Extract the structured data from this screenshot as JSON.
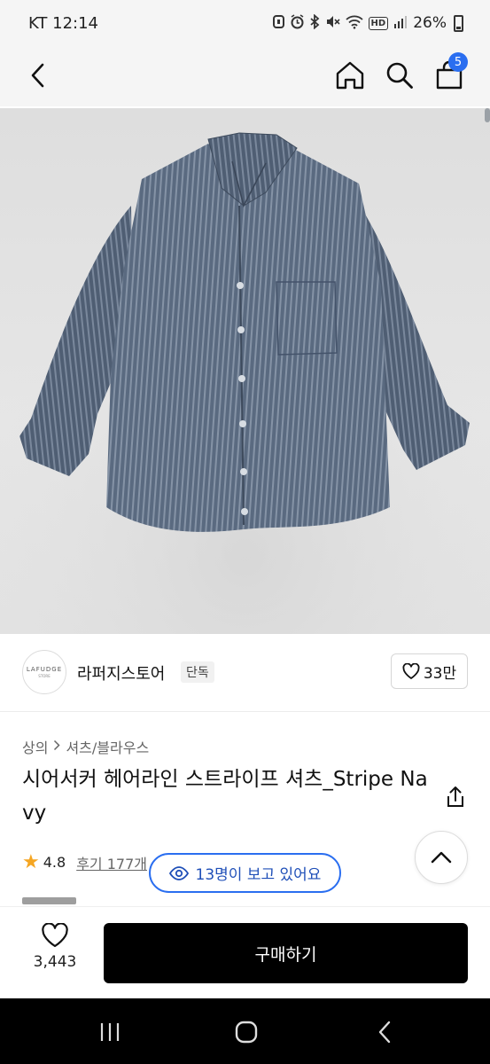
{
  "status_bar": {
    "carrier_time": "KT 12:14",
    "battery": "26%",
    "icons": [
      "sync-icon",
      "alarm-icon",
      "bluetooth-icon",
      "mute-icon",
      "wifi-icon",
      "hd-icon",
      "signal-icon",
      "battery-icon"
    ],
    "hd_label": "HD"
  },
  "header": {
    "icons": [
      "back-arrow-icon",
      "home-icon",
      "search-icon",
      "shopping-bag-icon"
    ],
    "cart_count": "5",
    "accent_color": "#2a6ef0"
  },
  "brand": {
    "logo_text": "LAFUDGE",
    "logo_subtext": "STORE",
    "name": "라퍼지스토어",
    "tag": "단독",
    "like_count": "33만"
  },
  "product": {
    "breadcrumb": [
      "상의",
      "셔츠/블라우스"
    ],
    "title": "시어서커 헤어라인 스트라이프 셔츠_Stripe Navy",
    "rating": "4.8",
    "reviews_label": "후기 177개",
    "viewers_text": "13명이 보고 있어요"
  },
  "buy_bar": {
    "wish_count": "3,443",
    "buy_label": "구매하기"
  },
  "nav_bar": {
    "icons": [
      "recent-apps-icon",
      "home-circle-icon",
      "nav-back-icon"
    ]
  }
}
